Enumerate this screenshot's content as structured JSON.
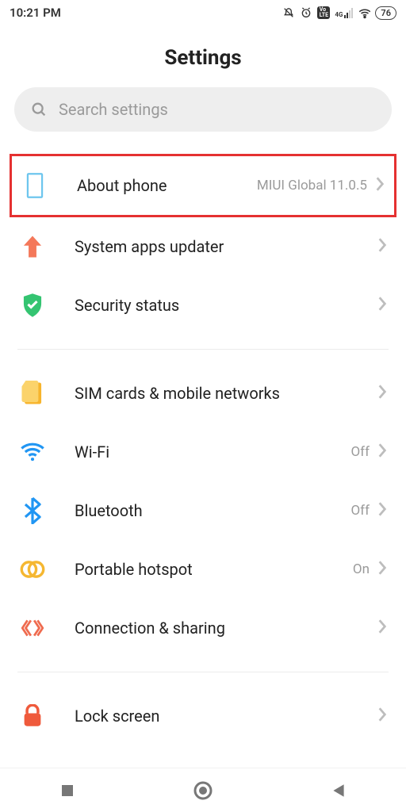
{
  "statusbar": {
    "time": "10:21 PM",
    "network_label": "4G",
    "battery": "76"
  },
  "header": {
    "title": "Settings"
  },
  "search": {
    "placeholder": "Search settings"
  },
  "sections": [
    {
      "items": [
        {
          "id": "about",
          "label": "About phone",
          "value": "MIUI Global 11.0.5",
          "highlight": true
        },
        {
          "id": "updater",
          "label": "System apps updater",
          "value": ""
        },
        {
          "id": "security",
          "label": "Security status",
          "value": ""
        }
      ]
    },
    {
      "items": [
        {
          "id": "sim",
          "label": "SIM cards & mobile networks",
          "value": ""
        },
        {
          "id": "wifi",
          "label": "Wi-Fi",
          "value": "Off"
        },
        {
          "id": "bt",
          "label": "Bluetooth",
          "value": "Off"
        },
        {
          "id": "hotspot",
          "label": "Portable hotspot",
          "value": "On"
        },
        {
          "id": "connshare",
          "label": "Connection & sharing",
          "value": ""
        }
      ]
    },
    {
      "items": [
        {
          "id": "lock",
          "label": "Lock screen",
          "value": ""
        }
      ]
    }
  ]
}
